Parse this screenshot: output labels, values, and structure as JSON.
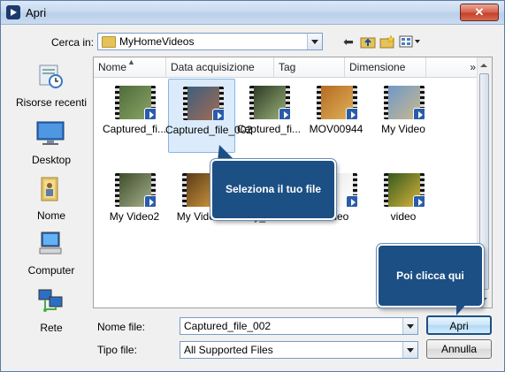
{
  "window": {
    "title": "Apri",
    "close_label": "✕"
  },
  "lookin": {
    "label": "Cerca in:",
    "value": "MyHomeVideos"
  },
  "places": [
    {
      "label": "Risorse recenti",
      "icon": "recent-places-icon"
    },
    {
      "label": "Desktop",
      "icon": "desktop-icon"
    },
    {
      "label": "Nome",
      "icon": "user-folder-icon"
    },
    {
      "label": "Computer",
      "icon": "computer-icon"
    },
    {
      "label": "Rete",
      "icon": "network-icon"
    }
  ],
  "columns": [
    "Nome",
    "Data acquisizione",
    "Tag",
    "Dimensione",
    "»"
  ],
  "files": [
    {
      "name": "Captured_fi...",
      "colors": [
        "#4f6b3a",
        "#8aa566"
      ]
    },
    {
      "name": "Captured_file_002",
      "selected": true,
      "colors": [
        "#3d5f7e",
        "#a36b52"
      ]
    },
    {
      "name": "Captured_fi...",
      "colors": [
        "#2c3a24",
        "#9bb07a"
      ]
    },
    {
      "name": "MOV00944",
      "colors": [
        "#b46b22",
        "#e0b15a"
      ]
    },
    {
      "name": "My Video",
      "colors": [
        "#6f98c7",
        "#c9b98f"
      ]
    },
    {
      "name": "My Video2",
      "colors": [
        "#3e4d2c",
        "#a5b08b"
      ]
    },
    {
      "name": "My Video3",
      "colors": [
        "#5a3b1a",
        "#d49a3c"
      ]
    },
    {
      "name": "My_Video",
      "colors": [
        "#c6c6c6",
        "#f4f4f4"
      ]
    },
    {
      "name": "video",
      "colors": [
        "#e9e9e9",
        "#ffffff"
      ]
    },
    {
      "name": "video",
      "colors": [
        "#355a20",
        "#d8b43a"
      ]
    }
  ],
  "callouts": {
    "select": "Seleziona il tuo file",
    "click": "Poi clicca qui"
  },
  "filename": {
    "label": "Nome file:",
    "value": "Captured_file_002"
  },
  "filetype": {
    "label": "Tipo file:",
    "value": "All Supported Files"
  },
  "buttons": {
    "open": "Apri",
    "cancel": "Annulla"
  }
}
